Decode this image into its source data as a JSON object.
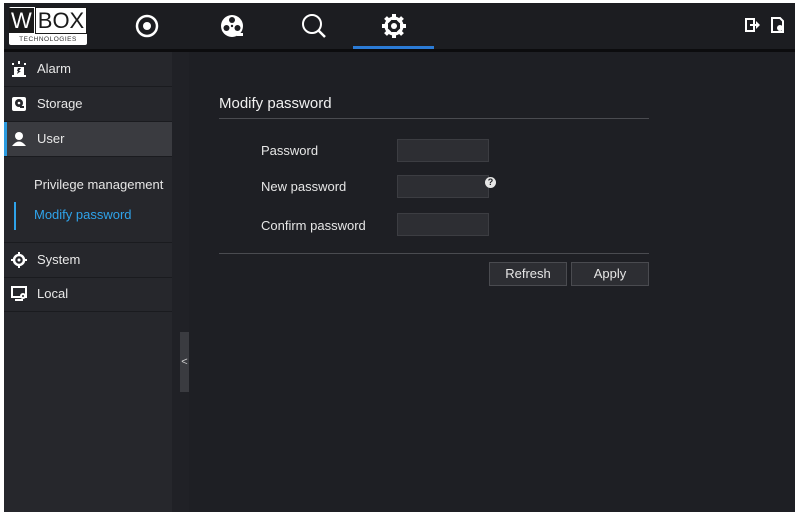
{
  "logo": {
    "brand_w": "W",
    "brand_box": "BOX",
    "tagline": "TECHNOLOGIES"
  },
  "nav": {
    "icons": [
      "live-view-icon",
      "playback-icon",
      "search-icon",
      "settings-icon"
    ],
    "active": "settings-icon",
    "accent": "#2b7bd6",
    "right_icons": [
      "logout-icon",
      "export-file-icon"
    ]
  },
  "sidebar": {
    "items": [
      {
        "label": "Alarm",
        "icon": "alarm-icon"
      },
      {
        "label": "Storage",
        "icon": "storage-icon"
      },
      {
        "label": "User",
        "icon": "user-icon",
        "active": true
      },
      {
        "label": "System",
        "icon": "system-gear-icon"
      },
      {
        "label": "Local",
        "icon": "local-monitor-icon"
      }
    ],
    "subitems": [
      {
        "label": "Privilege management"
      },
      {
        "label": "Modify password",
        "active": true
      }
    ],
    "collapse_label": "<",
    "active_color": "#2fa3ea"
  },
  "main": {
    "title": "Modify password",
    "fields": [
      {
        "label": "Password",
        "value": ""
      },
      {
        "label": "New password",
        "value": "",
        "help": "?"
      },
      {
        "label": "Confirm password",
        "value": ""
      }
    ],
    "buttons": {
      "refresh": "Refresh",
      "apply": "Apply"
    }
  }
}
